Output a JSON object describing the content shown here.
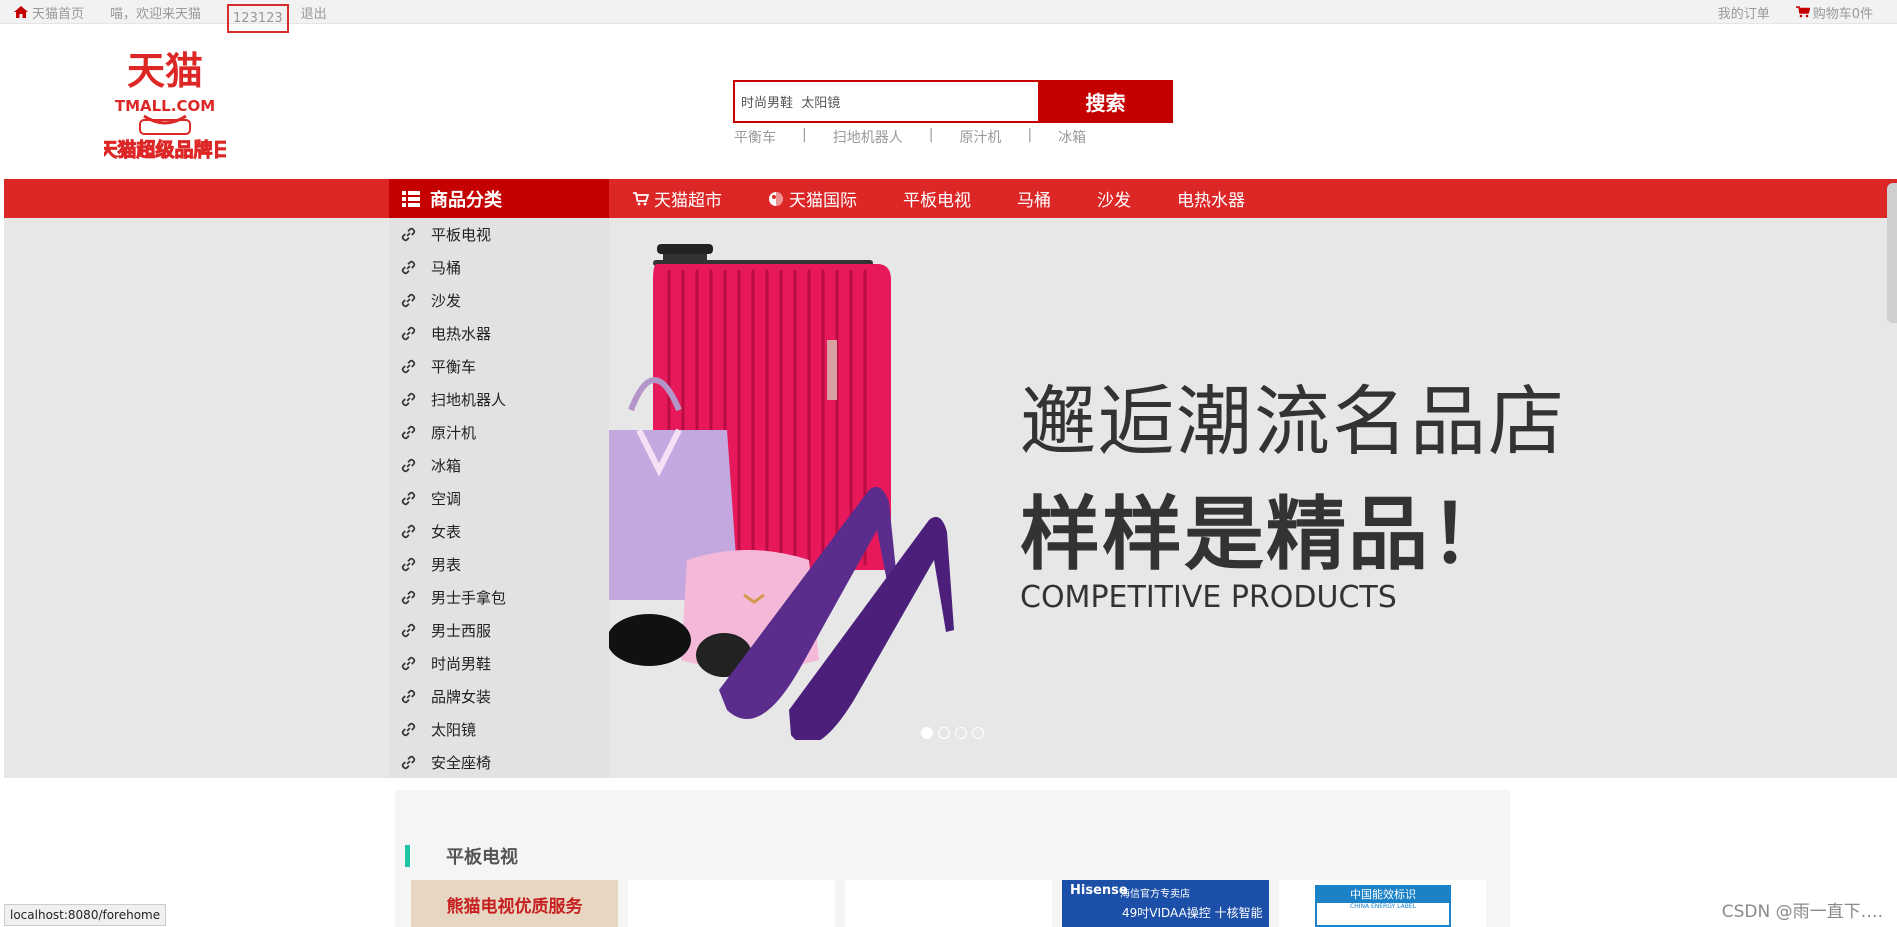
{
  "topbar": {
    "home": "天猫首页",
    "welcome": "喵，欢迎来天猫",
    "user": "123123",
    "logout": "退出",
    "orders": "我的订单",
    "cart": "购物车0件"
  },
  "logo": {
    "title": "天猫",
    "domain": "TMALL.COM",
    "slogan": "天猫超级品牌日"
  },
  "search": {
    "value": "时尚男鞋  太阳镜",
    "button": "搜索",
    "hotwords": [
      "平衡车",
      "扫地机器人",
      "原汁机",
      "冰箱"
    ],
    "separator": "|"
  },
  "nav": {
    "category_title": "商品分类",
    "links": [
      "天猫超市",
      "天猫国际",
      "平板电视",
      "马桶",
      "沙发",
      "电热水器"
    ]
  },
  "categories": [
    "平板电视",
    "马桶",
    "沙发",
    "电热水器",
    "平衡车",
    "扫地机器人",
    "原汁机",
    "冰箱",
    "空调",
    "女表",
    "男表",
    "男士手拿包",
    "男士西服",
    "时尚男鞋",
    "品牌女装",
    "太阳镜",
    "安全座椅"
  ],
  "banner": {
    "line1": "邂逅潮流名品店",
    "line2": "样样是精品！",
    "line3": "COMPETITIVE  PRODUCTS"
  },
  "floor": {
    "title": "平板电视",
    "p1_text": "熊猫电视优质服务",
    "p4_brand": "Hisense",
    "p4_sub": "海信官方专卖店",
    "p4_tag": "49吋VIDAA操控 十核智能",
    "p5_header": "中国能效标识",
    "p5_en": "CHINA ENERGY LABEL"
  },
  "status_url": "localhost:8080/forehome",
  "watermark": "CSDN @雨一直下….",
  "colors": {
    "brand_red": "#dd2727",
    "dark_red": "#c40000",
    "floor_accent": "#1fc6a6"
  }
}
